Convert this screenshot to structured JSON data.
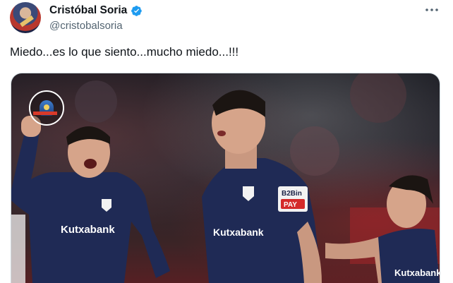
{
  "author": {
    "display_name": "Cristóbal Soria",
    "handle": "@cristobalsoria",
    "verified": true
  },
  "tweet": {
    "text": "Miedo...es lo que siento...mucho miedo...!!!"
  },
  "media": {
    "sponsor_text": "Kutxabank",
    "badge_line1": "B2Bin",
    "badge_line2": "PAY"
  },
  "colors": {
    "verified": "#1d9bf0",
    "jersey": "#1f2a55",
    "handle": "#536471"
  },
  "icons": {
    "more": "more-horizontal-icon",
    "verified": "verified-badge-icon"
  }
}
